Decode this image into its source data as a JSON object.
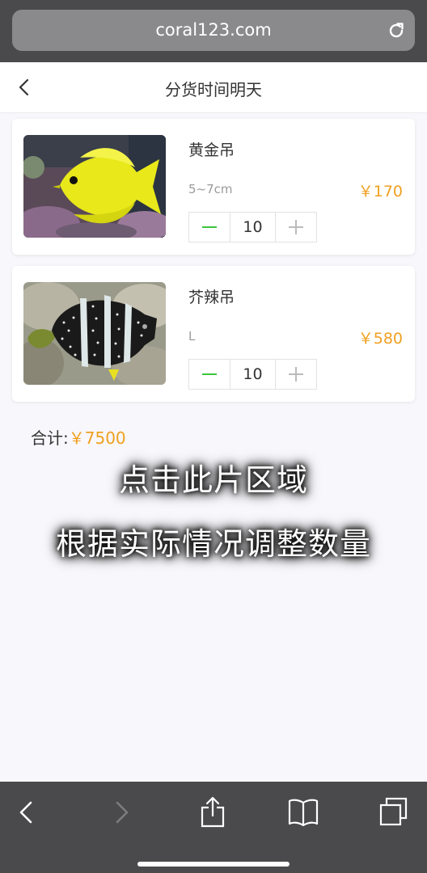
{
  "browser": {
    "url": "coral123.com",
    "icons": {
      "reload": "reload-icon",
      "back": "chevron-left-icon",
      "forward": "chevron-right-icon",
      "share": "share-icon",
      "bookmarks": "book-icon",
      "tabs": "tabs-icon"
    }
  },
  "header": {
    "title": "分货时间明天",
    "back_icon": "chevron-left-icon"
  },
  "items": [
    {
      "name": "黄金吊",
      "size": "5~7cm",
      "price": "￥170",
      "quantity": "10",
      "image": "yellow-tang-fish"
    },
    {
      "name": "芥辣吊",
      "size": "L",
      "price": "￥580",
      "quantity": "10",
      "image": "striped-tang-fish"
    }
  ],
  "total": {
    "label": "合计:",
    "value": "￥7500"
  },
  "overlay": {
    "line1": "点击此片区域",
    "line2": "根据实际情况调整数量"
  },
  "colors": {
    "accent_price": "#f0a020",
    "minus_green": "#3cc43c",
    "browser_bar": "#4a4a4c"
  }
}
